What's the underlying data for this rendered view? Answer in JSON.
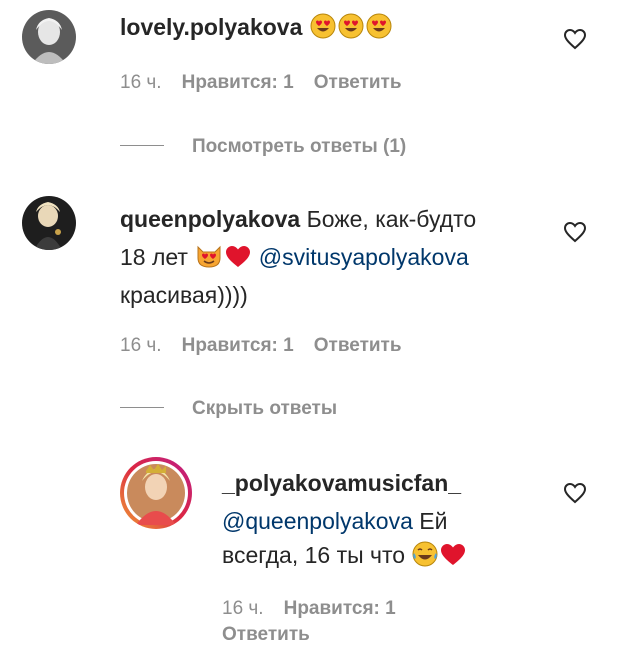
{
  "comments": [
    {
      "username": "lovely.polyakova",
      "text": "",
      "emojis": [
        "heart-eyes",
        "heart-eyes",
        "heart-eyes"
      ],
      "time": "16 ч.",
      "likes": "Нравится: 1",
      "reply": "Ответить",
      "replies_toggle": "Посмотреть ответы (1)"
    },
    {
      "username": "queenpolyakova",
      "text_line1": "Боже, как-будто",
      "text_line2_prefix": "18 лет",
      "mention": "@svitusyapolyakova",
      "text_line3": "красивая))))",
      "time": "16 ч.",
      "likes": "Нравится: 1",
      "reply": "Ответить",
      "replies_toggle": "Скрыть ответы"
    }
  ],
  "reply": {
    "username": "_polyakovamusicfan_",
    "mention": "@queenpolyakova",
    "text_line2_suffix": "Ей",
    "text_line3": "всегда, 16 ты что",
    "time": "16 ч.",
    "likes": "Нравится: 1",
    "reply": "Ответить"
  },
  "colors": {
    "username": "#262626",
    "mention": "#00376b",
    "meta": "#8e8e8e",
    "emoji_yellow": "#f7c131",
    "heart_red": "#e0142c"
  }
}
